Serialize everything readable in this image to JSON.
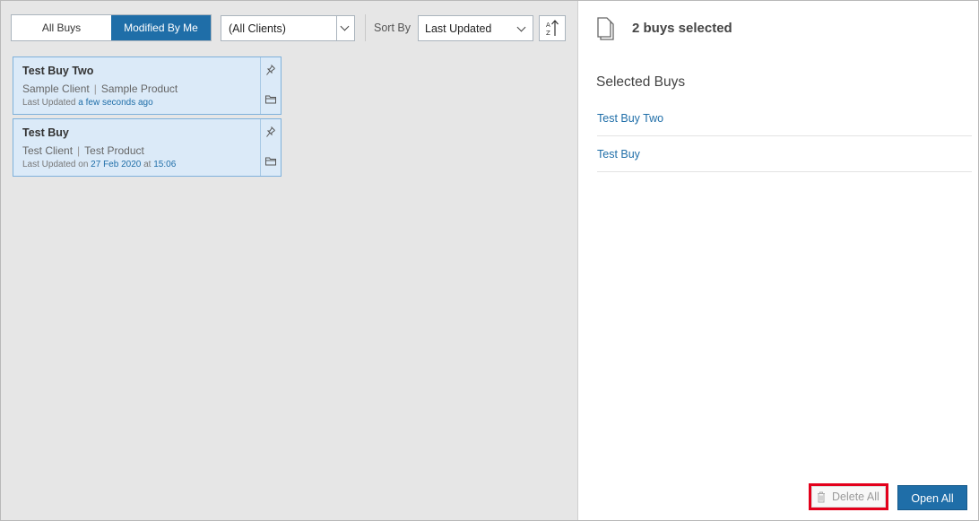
{
  "toolbar": {
    "tab_all": "All Buys",
    "tab_mine": "Modified By Me",
    "client_filter": "(All Clients)",
    "sort_label": "Sort By",
    "sort_value": "Last Updated"
  },
  "buys": [
    {
      "title": "Test Buy Two",
      "client": "Sample Client",
      "product": "Sample Product",
      "updated_prefix": "Last Updated",
      "updated_when": "a few seconds ago",
      "updated_mid": "",
      "updated_time": ""
    },
    {
      "title": "Test Buy",
      "client": "Test Client",
      "product": "Test Product",
      "updated_prefix": "Last Updated on",
      "updated_when": "27 Feb 2020",
      "updated_mid": "at",
      "updated_time": "15:06"
    }
  ],
  "selection": {
    "count_label": "2 buys selected",
    "heading": "Selected Buys",
    "items": [
      "Test Buy Two",
      "Test Buy"
    ],
    "delete_label": "Delete All",
    "open_label": "Open All"
  },
  "colors": {
    "accent": "#1f6ea8",
    "card_bg": "#dbeaf8",
    "highlight_border": "#e3001b"
  }
}
